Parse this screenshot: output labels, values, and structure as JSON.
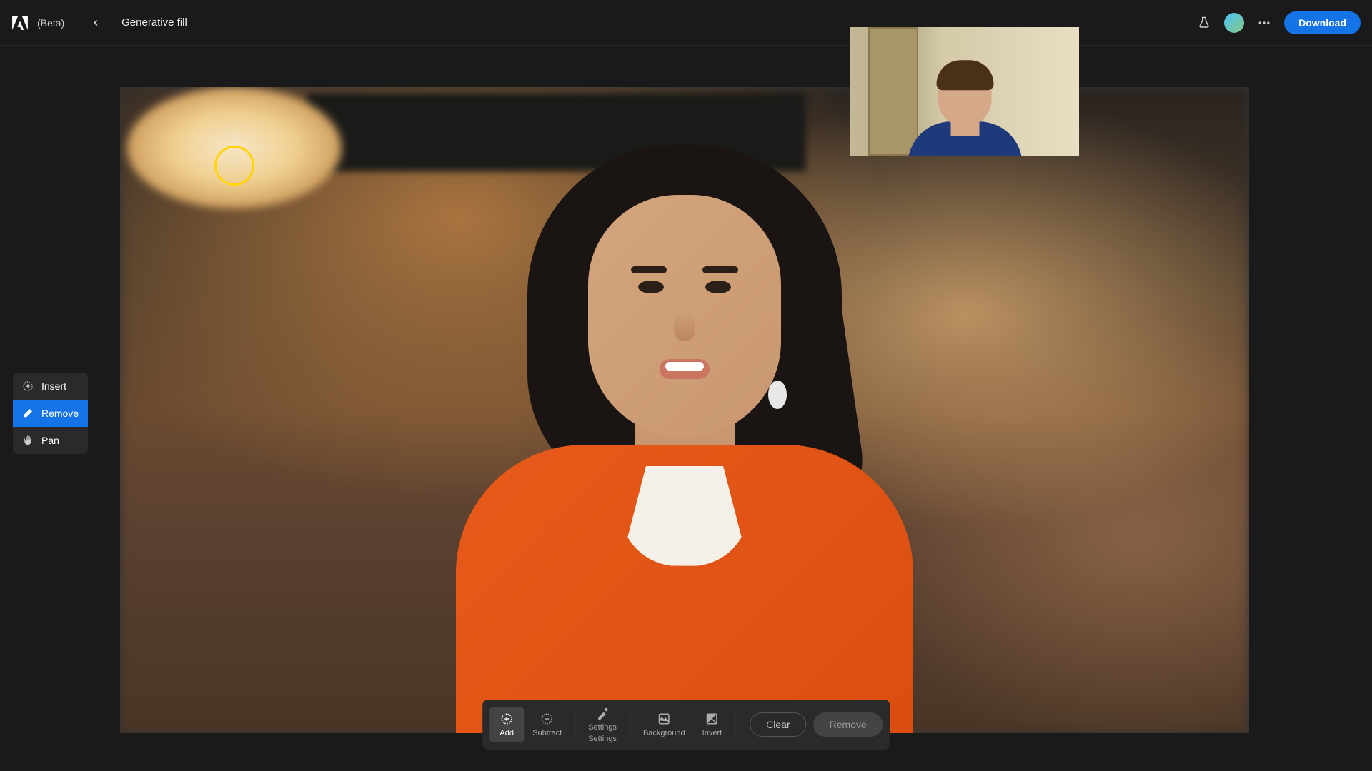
{
  "header": {
    "beta_label": "(Beta)",
    "page_title": "Generative fill",
    "download_label": "Download"
  },
  "side_tools": {
    "insert": "Insert",
    "remove": "Remove",
    "pan": "Pan",
    "active": "remove"
  },
  "bottom_bar": {
    "add": "Add",
    "subtract": "Subtract",
    "settings": "Settings",
    "background": "Background",
    "invert": "Invert",
    "clear": "Clear",
    "remove": "Remove",
    "active": "add"
  }
}
